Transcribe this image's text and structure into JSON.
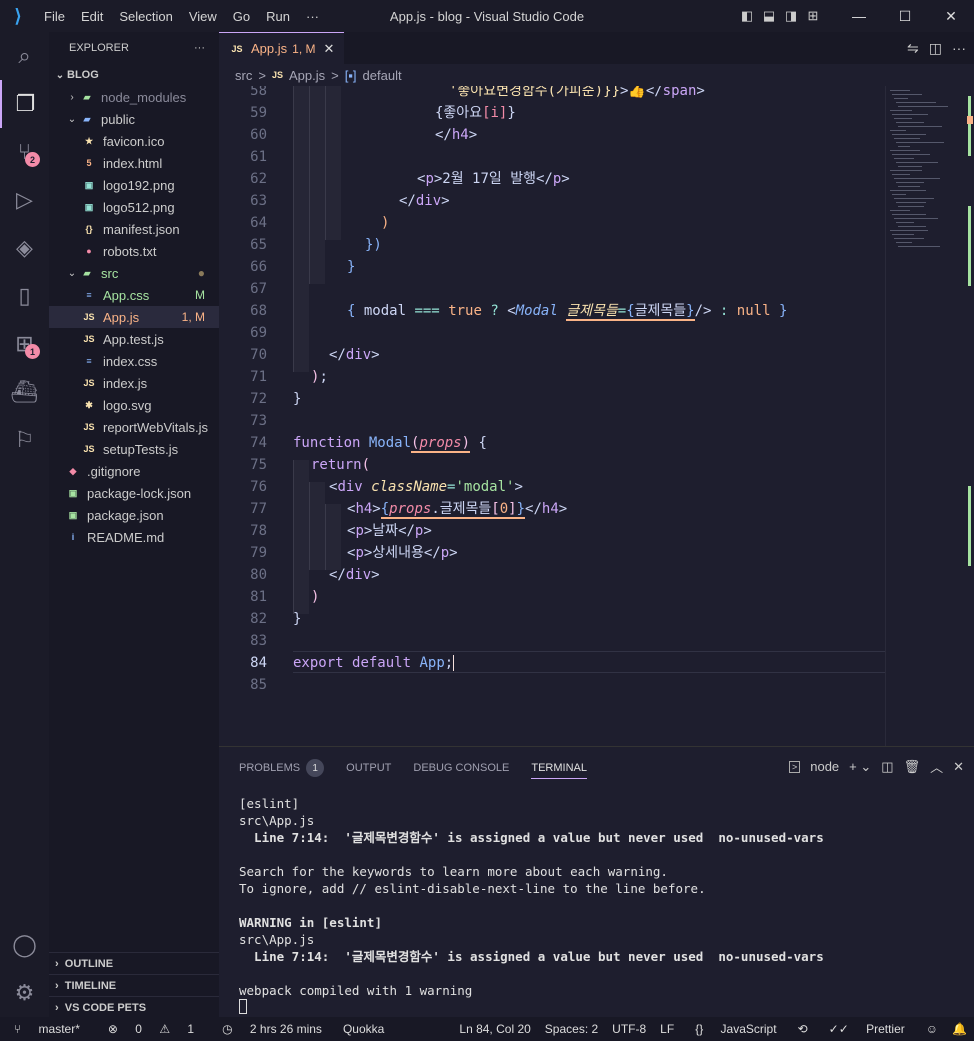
{
  "titlebar": {
    "menu": [
      "File",
      "Edit",
      "Selection",
      "View",
      "Go",
      "Run",
      "···"
    ],
    "title": "App.js - blog - Visual Studio Code"
  },
  "activity": {
    "source_control_badge": "2",
    "extensions_badge": "1"
  },
  "sidebar": {
    "title": "EXPLORER",
    "more": "···",
    "root": "BLOG",
    "items": [
      {
        "name": "node_modules",
        "indent": 1,
        "type": "folder",
        "open": false,
        "color": "#8a8a9a"
      },
      {
        "name": "public",
        "indent": 1,
        "type": "folder",
        "open": true,
        "color": "#cccccc"
      },
      {
        "name": "favicon.ico",
        "indent": 2,
        "icon": "★",
        "iconColor": "#f9e2af",
        "color": "#cccccc"
      },
      {
        "name": "index.html",
        "indent": 2,
        "icon": "5",
        "iconColor": "#fab387",
        "color": "#cccccc"
      },
      {
        "name": "logo192.png",
        "indent": 2,
        "icon": "▣",
        "iconColor": "#94e2d5",
        "color": "#cccccc"
      },
      {
        "name": "logo512.png",
        "indent": 2,
        "icon": "▣",
        "iconColor": "#94e2d5",
        "color": "#cccccc"
      },
      {
        "name": "manifest.json",
        "indent": 2,
        "icon": "{}",
        "iconColor": "#f9e2af",
        "color": "#cccccc"
      },
      {
        "name": "robots.txt",
        "indent": 2,
        "icon": "●",
        "iconColor": "#f38ba8",
        "color": "#cccccc"
      },
      {
        "name": "src",
        "indent": 1,
        "type": "folder",
        "open": true,
        "color": "#a6e3a1",
        "status": "●",
        "statusColor": "#8a7a5a"
      },
      {
        "name": "App.css",
        "indent": 2,
        "icon": "≡",
        "iconColor": "#89b4fa",
        "color": "#a6e3a1",
        "status": "M",
        "statusColor": "#a6e3a1"
      },
      {
        "name": "App.js",
        "indent": 2,
        "icon": "JS",
        "iconColor": "#f9e2af",
        "color": "#fab387",
        "status": "1, M",
        "statusColor": "#fab387"
      },
      {
        "name": "App.test.js",
        "indent": 2,
        "icon": "JS",
        "iconColor": "#f9e2af",
        "color": "#cccccc"
      },
      {
        "name": "index.css",
        "indent": 2,
        "icon": "≡",
        "iconColor": "#89b4fa",
        "color": "#cccccc"
      },
      {
        "name": "index.js",
        "indent": 2,
        "icon": "JS",
        "iconColor": "#f9e2af",
        "color": "#cccccc"
      },
      {
        "name": "logo.svg",
        "indent": 2,
        "icon": "✱",
        "iconColor": "#f9e2af",
        "color": "#cccccc"
      },
      {
        "name": "reportWebVitals.js",
        "indent": 2,
        "icon": "JS",
        "iconColor": "#f9e2af",
        "color": "#cccccc"
      },
      {
        "name": "setupTests.js",
        "indent": 2,
        "icon": "JS",
        "iconColor": "#f9e2af",
        "color": "#cccccc"
      },
      {
        "name": ".gitignore",
        "indent": 1,
        "icon": "◆",
        "iconColor": "#f38ba8",
        "color": "#cccccc"
      },
      {
        "name": "package-lock.json",
        "indent": 1,
        "icon": "▣",
        "iconColor": "#a6e3a1",
        "color": "#cccccc"
      },
      {
        "name": "package.json",
        "indent": 1,
        "icon": "▣",
        "iconColor": "#a6e3a1",
        "color": "#cccccc"
      },
      {
        "name": "README.md",
        "indent": 1,
        "icon": "i",
        "iconColor": "#89b4fa",
        "color": "#cccccc"
      }
    ],
    "bottom": [
      "OUTLINE",
      "TIMELINE",
      "VS CODE PETS"
    ]
  },
  "tab": {
    "label": "App.js",
    "status": "1, M",
    "close": "✕"
  },
  "breadcrumb": [
    "src",
    ">",
    "App.js",
    ">",
    "default"
  ],
  "editor": {
    "line_numbers": [
      "58",
      "59",
      "60",
      "61",
      "62",
      "63",
      "64",
      "65",
      "66",
      "67",
      "68",
      "69",
      "70",
      "71",
      "72",
      "73",
      "74",
      "75",
      "76",
      "77",
      "78",
      "79",
      "80",
      "81",
      "82",
      "83",
      "84",
      "85"
    ],
    "current_line": "84"
  },
  "panel": {
    "tabs": [
      "PROBLEMS",
      "OUTPUT",
      "DEBUG CONSOLE",
      "TERMINAL"
    ],
    "problems_count": "1",
    "terminal_name": "node",
    "terminal_lines": [
      "[eslint]",
      "src\\App.js",
      "  Line 7:14:  '글제목변경함수' is assigned a value but never used  no-unused-vars",
      "",
      "Search for the keywords to learn more about each warning.",
      "To ignore, add // eslint-disable-next-line to the line before.",
      "",
      "WARNING in [eslint]",
      "src\\App.js",
      "  Line 7:14:  '글제목변경함수' is assigned a value but never used  no-unused-vars",
      "",
      "webpack compiled with 1 warning"
    ]
  },
  "statusbar": {
    "branch": "master*",
    "errors": "0",
    "warnings": "1",
    "time": "2 hrs 26 mins",
    "quokka": "Quokka",
    "position": "Ln 84, Col 20",
    "spaces": "Spaces: 2",
    "encoding": "UTF-8",
    "eol": "LF",
    "language": "JavaScript",
    "prettier": "Prettier"
  }
}
